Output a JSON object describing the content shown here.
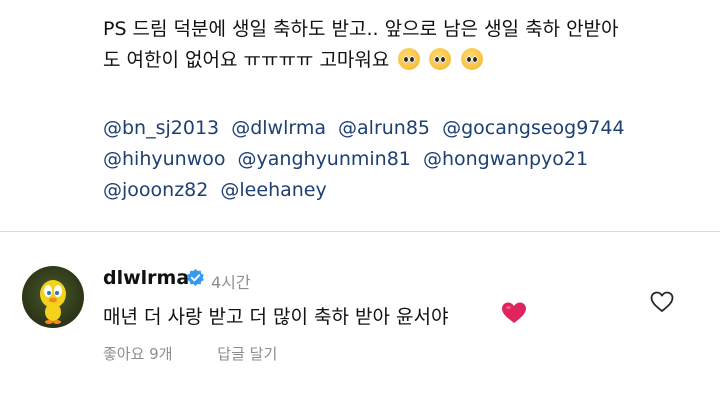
{
  "post": {
    "caption_line1": "PS 드림 덕분에 생일 축하도 받고.. 앞으로 남은 생일 축하 안받아",
    "caption_line2": "도 여한이 없어요 ㅠㅠㅠㅠ 고마워요",
    "emoji_name": "pleading-face",
    "mentions": [
      "@bn_sj2013",
      "@dlwlrma",
      "@alrun85",
      "@gocangseog9744",
      "@hihyunwoo",
      "@yanghyunmin81",
      "@hongwanpyo21",
      "@jooonz82",
      "@leehaney"
    ]
  },
  "comment": {
    "username": "dlwlrma",
    "verified_icon": "verified-badge-icon",
    "time": "4시간",
    "text": "매년 더 사랑 받고 더 많이 축하 받아 윤서야",
    "emoji_name": "red-heart",
    "likes": "좋아요 9개",
    "reply_label": "답글 달기"
  },
  "colors": {
    "mention": "#1e3f72",
    "verified": "#3897f0",
    "heart": "#e0245e",
    "muted": "#8e8e8e"
  }
}
